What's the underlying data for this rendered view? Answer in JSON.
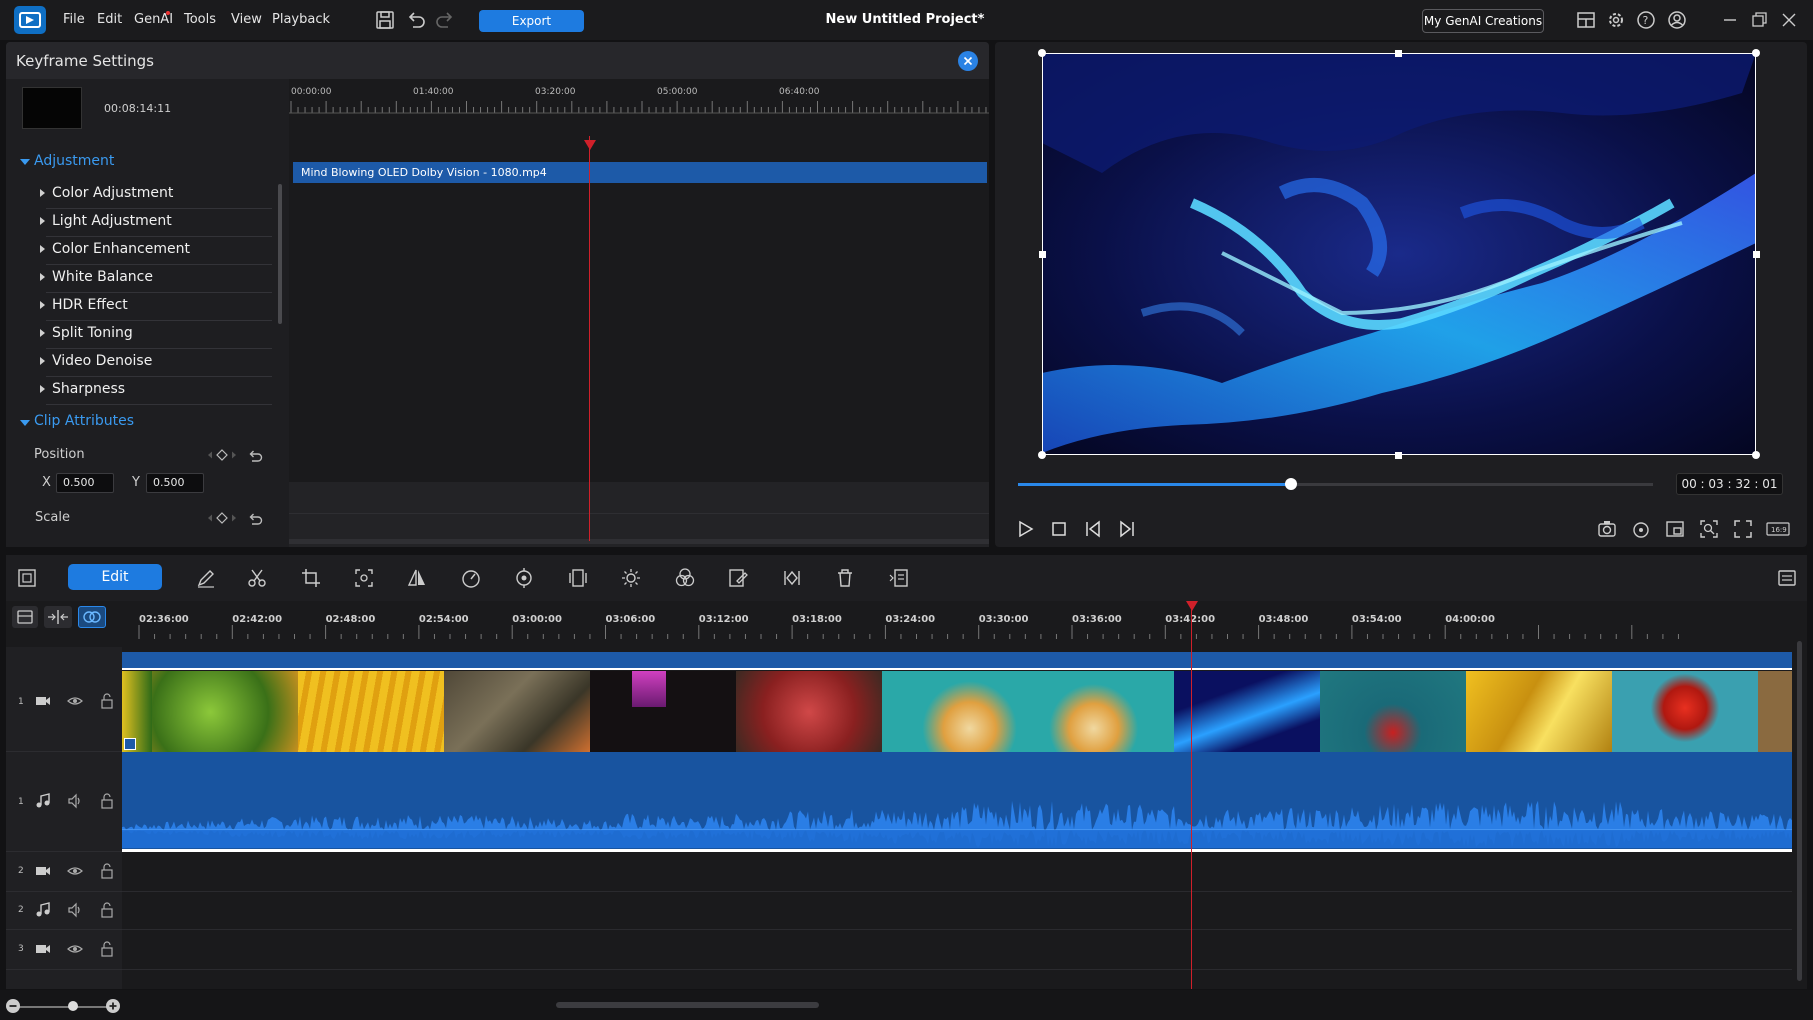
{
  "menu": [
    "File",
    "Edit",
    "GenAI",
    "Tools",
    "View",
    "Playback"
  ],
  "export_label": "Export",
  "project_title": "New Untitled Project*",
  "genai_creations_label": "My GenAI Creations",
  "keyframe": {
    "title": "Keyframe Settings",
    "clip_time": "00:08:14:11",
    "ruler_ticks": [
      "00:00:00",
      "01:40:00",
      "03:20:00",
      "05:00:00",
      "06:40:00"
    ],
    "clip_name": "Mind Blowing OLED Dolby Vision - 1080.mp4",
    "sections": {
      "adjustment": "Adjustment",
      "clip_attributes": "Clip Attributes"
    },
    "adjustment_items": [
      "Color Adjustment",
      "Light Adjustment",
      "Color Enhancement",
      "White Balance",
      "HDR Effect",
      "Split Toning",
      "Video Denoise",
      "Sharpness"
    ],
    "position_label": "Position",
    "x_label": "X",
    "x_value": "0.500",
    "y_label": "Y",
    "y_value": "0.500",
    "scale_label": "Scale"
  },
  "preview": {
    "timecode": "00 : 03 : 32 : 01",
    "seek_progress": 0.43,
    "aspect_label": "16:9"
  },
  "edit_label": "Edit",
  "timeline": {
    "ruler_ticks": [
      "02:36:00",
      "02:42:00",
      "02:48:00",
      "02:54:00",
      "03:00:00",
      "03:06:00",
      "03:12:00",
      "03:18:00",
      "03:24:00",
      "03:30:00",
      "03:36:00",
      "03:42:00",
      "03:48:00",
      "03:54:00",
      "04:00:00"
    ],
    "tracks": [
      {
        "num": "1",
        "type": "video"
      },
      {
        "num": "1",
        "type": "audio"
      },
      {
        "num": "2",
        "type": "video"
      },
      {
        "num": "2",
        "type": "audio"
      },
      {
        "num": "3",
        "type": "video"
      }
    ]
  },
  "colors": {
    "accent": "#1e7be0",
    "playhead": "#d0202a",
    "audio": "#1854a0"
  }
}
